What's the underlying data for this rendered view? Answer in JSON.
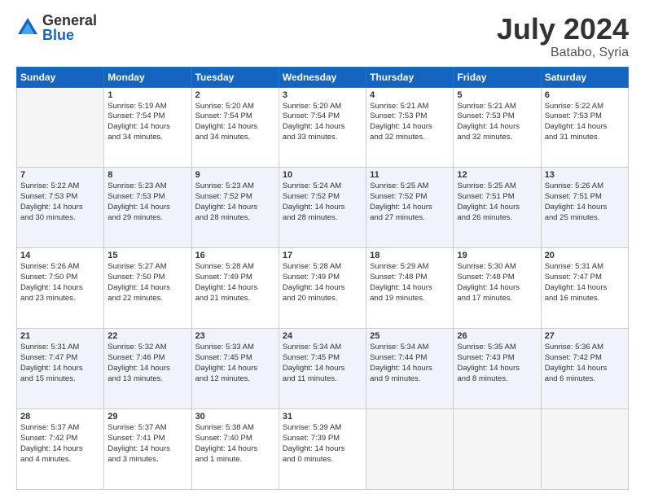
{
  "logo": {
    "general": "General",
    "blue": "Blue"
  },
  "header": {
    "month": "July 2024",
    "location": "Batabo, Syria"
  },
  "days": [
    "Sunday",
    "Monday",
    "Tuesday",
    "Wednesday",
    "Thursday",
    "Friday",
    "Saturday"
  ],
  "weeks": [
    [
      {
        "num": "",
        "lines": []
      },
      {
        "num": "1",
        "lines": [
          "Sunrise: 5:19 AM",
          "Sunset: 7:54 PM",
          "Daylight: 14 hours",
          "and 34 minutes."
        ]
      },
      {
        "num": "2",
        "lines": [
          "Sunrise: 5:20 AM",
          "Sunset: 7:54 PM",
          "Daylight: 14 hours",
          "and 34 minutes."
        ]
      },
      {
        "num": "3",
        "lines": [
          "Sunrise: 5:20 AM",
          "Sunset: 7:54 PM",
          "Daylight: 14 hours",
          "and 33 minutes."
        ]
      },
      {
        "num": "4",
        "lines": [
          "Sunrise: 5:21 AM",
          "Sunset: 7:53 PM",
          "Daylight: 14 hours",
          "and 32 minutes."
        ]
      },
      {
        "num": "5",
        "lines": [
          "Sunrise: 5:21 AM",
          "Sunset: 7:53 PM",
          "Daylight: 14 hours",
          "and 32 minutes."
        ]
      },
      {
        "num": "6",
        "lines": [
          "Sunrise: 5:22 AM",
          "Sunset: 7:53 PM",
          "Daylight: 14 hours",
          "and 31 minutes."
        ]
      }
    ],
    [
      {
        "num": "7",
        "lines": [
          "Sunrise: 5:22 AM",
          "Sunset: 7:53 PM",
          "Daylight: 14 hours",
          "and 30 minutes."
        ]
      },
      {
        "num": "8",
        "lines": [
          "Sunrise: 5:23 AM",
          "Sunset: 7:53 PM",
          "Daylight: 14 hours",
          "and 29 minutes."
        ]
      },
      {
        "num": "9",
        "lines": [
          "Sunrise: 5:23 AM",
          "Sunset: 7:52 PM",
          "Daylight: 14 hours",
          "and 28 minutes."
        ]
      },
      {
        "num": "10",
        "lines": [
          "Sunrise: 5:24 AM",
          "Sunset: 7:52 PM",
          "Daylight: 14 hours",
          "and 28 minutes."
        ]
      },
      {
        "num": "11",
        "lines": [
          "Sunrise: 5:25 AM",
          "Sunset: 7:52 PM",
          "Daylight: 14 hours",
          "and 27 minutes."
        ]
      },
      {
        "num": "12",
        "lines": [
          "Sunrise: 5:25 AM",
          "Sunset: 7:51 PM",
          "Daylight: 14 hours",
          "and 26 minutes."
        ]
      },
      {
        "num": "13",
        "lines": [
          "Sunrise: 5:26 AM",
          "Sunset: 7:51 PM",
          "Daylight: 14 hours",
          "and 25 minutes."
        ]
      }
    ],
    [
      {
        "num": "14",
        "lines": [
          "Sunrise: 5:26 AM",
          "Sunset: 7:50 PM",
          "Daylight: 14 hours",
          "and 23 minutes."
        ]
      },
      {
        "num": "15",
        "lines": [
          "Sunrise: 5:27 AM",
          "Sunset: 7:50 PM",
          "Daylight: 14 hours",
          "and 22 minutes."
        ]
      },
      {
        "num": "16",
        "lines": [
          "Sunrise: 5:28 AM",
          "Sunset: 7:49 PM",
          "Daylight: 14 hours",
          "and 21 minutes."
        ]
      },
      {
        "num": "17",
        "lines": [
          "Sunrise: 5:28 AM",
          "Sunset: 7:49 PM",
          "Daylight: 14 hours",
          "and 20 minutes."
        ]
      },
      {
        "num": "18",
        "lines": [
          "Sunrise: 5:29 AM",
          "Sunset: 7:48 PM",
          "Daylight: 14 hours",
          "and 19 minutes."
        ]
      },
      {
        "num": "19",
        "lines": [
          "Sunrise: 5:30 AM",
          "Sunset: 7:48 PM",
          "Daylight: 14 hours",
          "and 17 minutes."
        ]
      },
      {
        "num": "20",
        "lines": [
          "Sunrise: 5:31 AM",
          "Sunset: 7:47 PM",
          "Daylight: 14 hours",
          "and 16 minutes."
        ]
      }
    ],
    [
      {
        "num": "21",
        "lines": [
          "Sunrise: 5:31 AM",
          "Sunset: 7:47 PM",
          "Daylight: 14 hours",
          "and 15 minutes."
        ]
      },
      {
        "num": "22",
        "lines": [
          "Sunrise: 5:32 AM",
          "Sunset: 7:46 PM",
          "Daylight: 14 hours",
          "and 13 minutes."
        ]
      },
      {
        "num": "23",
        "lines": [
          "Sunrise: 5:33 AM",
          "Sunset: 7:45 PM",
          "Daylight: 14 hours",
          "and 12 minutes."
        ]
      },
      {
        "num": "24",
        "lines": [
          "Sunrise: 5:34 AM",
          "Sunset: 7:45 PM",
          "Daylight: 14 hours",
          "and 11 minutes."
        ]
      },
      {
        "num": "25",
        "lines": [
          "Sunrise: 5:34 AM",
          "Sunset: 7:44 PM",
          "Daylight: 14 hours",
          "and 9 minutes."
        ]
      },
      {
        "num": "26",
        "lines": [
          "Sunrise: 5:35 AM",
          "Sunset: 7:43 PM",
          "Daylight: 14 hours",
          "and 8 minutes."
        ]
      },
      {
        "num": "27",
        "lines": [
          "Sunrise: 5:36 AM",
          "Sunset: 7:42 PM",
          "Daylight: 14 hours",
          "and 6 minutes."
        ]
      }
    ],
    [
      {
        "num": "28",
        "lines": [
          "Sunrise: 5:37 AM",
          "Sunset: 7:42 PM",
          "Daylight: 14 hours",
          "and 4 minutes."
        ]
      },
      {
        "num": "29",
        "lines": [
          "Sunrise: 5:37 AM",
          "Sunset: 7:41 PM",
          "Daylight: 14 hours",
          "and 3 minutes."
        ]
      },
      {
        "num": "30",
        "lines": [
          "Sunrise: 5:38 AM",
          "Sunset: 7:40 PM",
          "Daylight: 14 hours",
          "and 1 minute."
        ]
      },
      {
        "num": "31",
        "lines": [
          "Sunrise: 5:39 AM",
          "Sunset: 7:39 PM",
          "Daylight: 14 hours",
          "and 0 minutes."
        ]
      },
      {
        "num": "",
        "lines": []
      },
      {
        "num": "",
        "lines": []
      },
      {
        "num": "",
        "lines": []
      }
    ]
  ]
}
